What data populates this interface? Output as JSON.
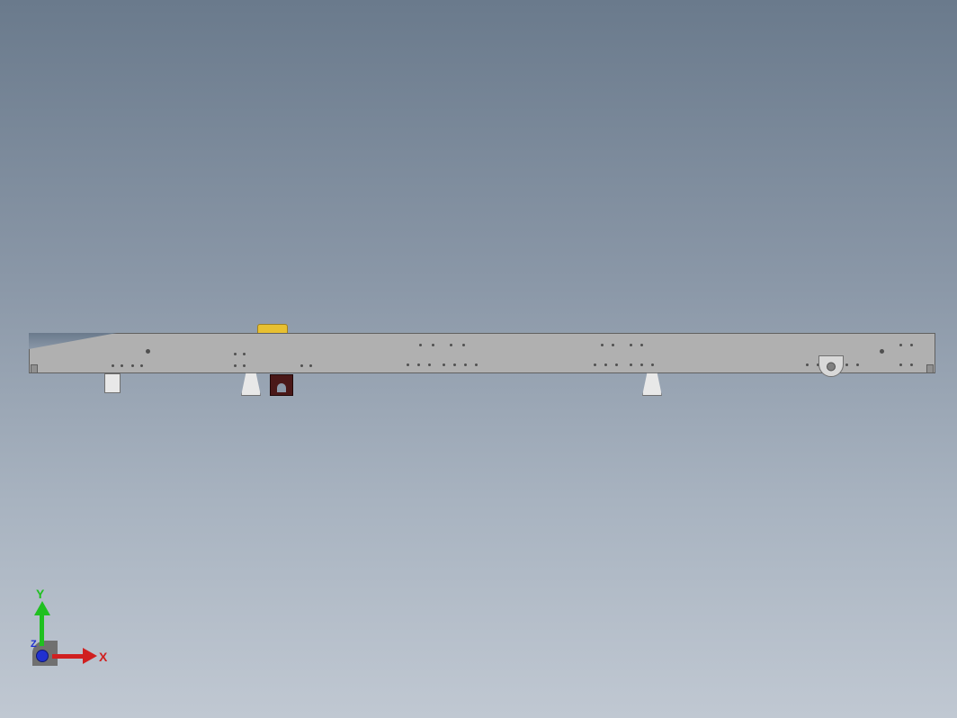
{
  "triad": {
    "x_label": "X",
    "y_label": "Y",
    "z_label": "Z"
  },
  "model": {
    "frame_color": "#b0b0b0",
    "accent_yellow": "#e8c030",
    "accent_dark": "#4a1818",
    "bracket_color": "#e8e8e8"
  }
}
